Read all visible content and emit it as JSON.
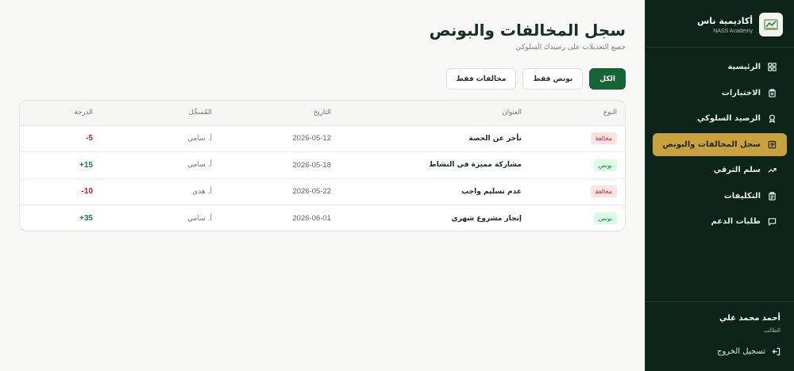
{
  "brand": {
    "name": "أكاديمية ناس",
    "subtitle": "NASS Academy"
  },
  "nav": {
    "items": [
      {
        "label": "الرئيسية",
        "icon": "grid-icon",
        "active": false
      },
      {
        "label": "الاختبارات",
        "icon": "clipboard-icon",
        "active": false
      },
      {
        "label": "الرصيد السلوكي",
        "icon": "award-icon",
        "active": false
      },
      {
        "label": "سجل المخالفات والبونص",
        "icon": "list-icon",
        "active": true
      },
      {
        "label": "سلم الترقي",
        "icon": "trending-up-icon",
        "active": false
      },
      {
        "label": "التكليفات",
        "icon": "clipboard-list-icon",
        "active": false
      },
      {
        "label": "طلبات الدعم",
        "icon": "message-icon",
        "active": false
      }
    ]
  },
  "user": {
    "name": "أحمد محمد علي",
    "role": "الطالب"
  },
  "logout_label": "تسجيل الخروج",
  "page": {
    "title": "سجل المخالفات والبونص",
    "subtitle": "جميع التعديلات على رصيدك السلوكي"
  },
  "filters": {
    "all": "الكل",
    "bonus_only": "بونص فقط",
    "violations_only": "مخالفات فقط",
    "selected": "all"
  },
  "table": {
    "headers": {
      "type": "النوع",
      "title": "العنوان",
      "date": "التاريخ",
      "recorder": "المُسجِّل",
      "score": "الدرجة"
    },
    "rows": [
      {
        "type": "مخالفة",
        "kind": "violation",
        "title": "تأخر عن الحصة",
        "date": "2026-05-12",
        "recorder": "أ. سامي",
        "score": "-5"
      },
      {
        "type": "بونص",
        "kind": "bonus",
        "title": "مشاركة مميزة في النشاط",
        "date": "2026-05-18",
        "recorder": "أ. سامي",
        "score": "+15"
      },
      {
        "type": "مخالفة",
        "kind": "violation",
        "title": "عدم تسليم واجب",
        "date": "2026-05-22",
        "recorder": "أ. هدى",
        "score": "-10"
      },
      {
        "type": "بونص",
        "kind": "bonus",
        "title": "إنجاز مشروع شهري",
        "date": "2026-06-01",
        "recorder": "أ. سامي",
        "score": "+35"
      }
    ]
  },
  "colors": {
    "sidebar_bg": "#0c2417",
    "accent_gold": "#c9a13e",
    "primary_green": "#166534",
    "violation_bg": "#fde2e2",
    "violation_text": "#b91c1c",
    "bonus_bg": "#dcfce7",
    "bonus_text": "#15803d",
    "negative_score": "#b91c1c",
    "positive_score": "#15803d"
  }
}
